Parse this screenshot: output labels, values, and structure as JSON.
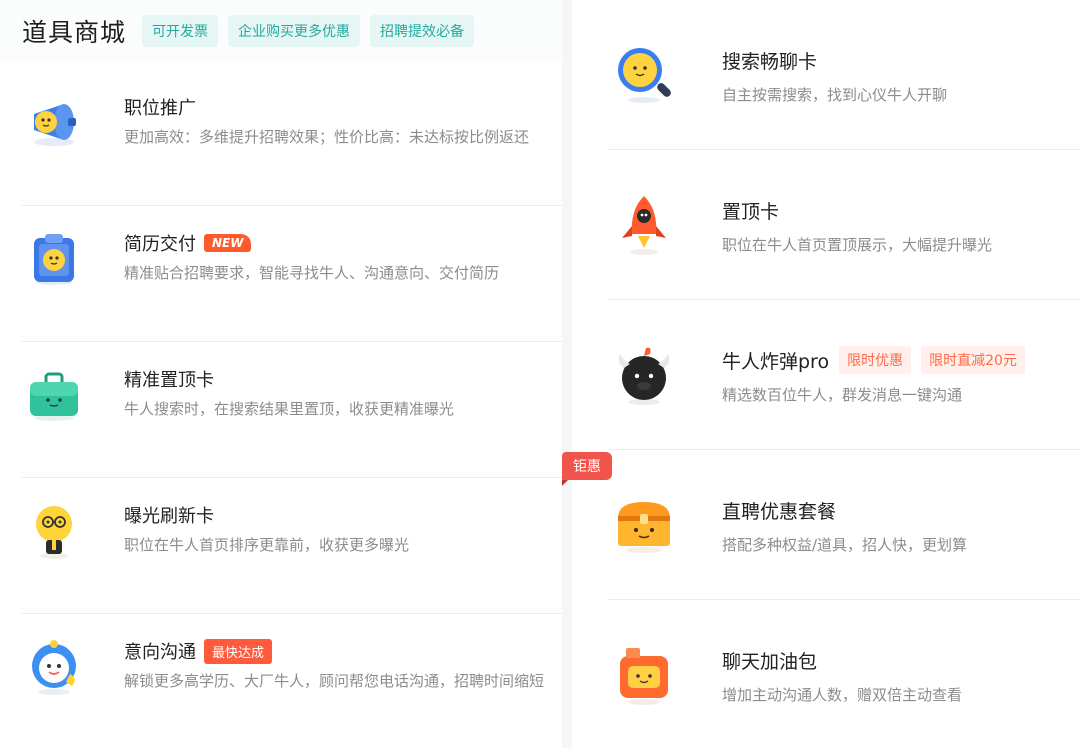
{
  "header": {
    "title": "道具商城",
    "tags": [
      "可开发票",
      "企业购买更多优惠",
      "招聘提效必备"
    ]
  },
  "left_items": [
    {
      "icon": "megaphone-icon",
      "title": "职位推广",
      "desc": "更加高效：多维提升招聘效果；性价比高：未达标按比例返还"
    },
    {
      "icon": "clipboard-icon",
      "title": "简历交付",
      "badge": "NEW",
      "desc": "精准贴合招聘要求，智能寻找牛人、沟通意向、交付简历"
    },
    {
      "icon": "briefcase-icon",
      "title": "精准置顶卡",
      "desc": "牛人搜索时，在搜索结果里置顶，收获更精准曝光"
    },
    {
      "icon": "lightbulb-icon",
      "title": "曝光刷新卡",
      "desc": "职位在牛人首页排序更靠前，收获更多曝光"
    },
    {
      "icon": "phone-mascot-icon",
      "title": "意向沟通",
      "badge": "最快达成",
      "desc": "解锁更多高学历、大厂牛人，顾问帮您电话沟通，招聘时间缩短"
    }
  ],
  "right_items": [
    {
      "icon": "magnifier-icon",
      "title": "搜索畅聊卡",
      "desc": "自主按需搜索，找到心仪牛人开聊"
    },
    {
      "icon": "rocket-icon",
      "title": "置顶卡",
      "desc": "职位在牛人首页置顶展示，大幅提升曝光"
    },
    {
      "icon": "bull-bomb-icon",
      "title": "牛人炸弹pro",
      "badges": [
        "限时优惠",
        "限时直减20元"
      ],
      "desc": "精选数百位牛人，群发消息一键沟通"
    },
    {
      "icon": "treasure-chest-icon",
      "title": "直聘优惠套餐",
      "desc": "搭配多种权益/道具，招人快，更划算"
    },
    {
      "icon": "fuel-can-icon",
      "title": "聊天加油包",
      "desc": "增加主动沟通人数，赠双倍主动查看"
    }
  ],
  "ribbon": "钜惠",
  "colors": {
    "accent_teal": "#23a9a2",
    "tag_bg": "#e6f6f4",
    "badge_red": "#ff5a3c",
    "badge_pink_text": "#ff6a4a",
    "badge_pink_bg": "#fff0ec",
    "ribbon": "#f0544a"
  }
}
